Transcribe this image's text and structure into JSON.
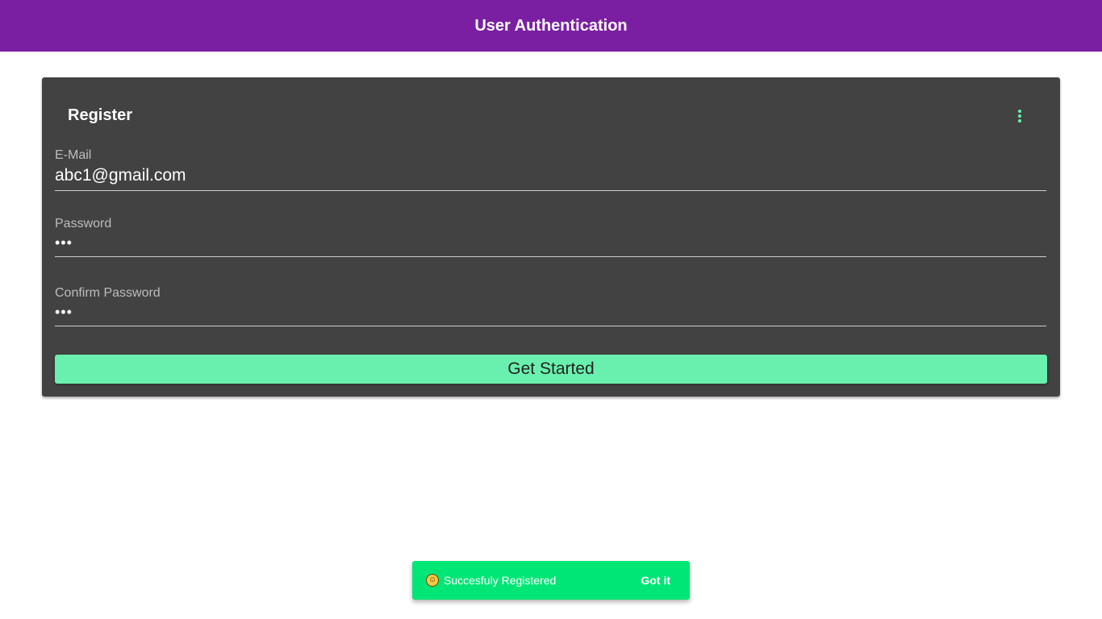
{
  "app_bar": {
    "title": "User Authentication",
    "color": "#7b1fa2"
  },
  "card": {
    "title": "Register",
    "menu_icon": "more-vert-icon",
    "fields": {
      "email": {
        "label": "E-Mail",
        "value": "abc1@gmail.com"
      },
      "password": {
        "label": "Password",
        "value": "•••"
      },
      "confirm_password": {
        "label": "Confirm Password",
        "value": "•••"
      }
    },
    "submit_label": "Get Started",
    "accent_color": "#69f0ae"
  },
  "snackbar": {
    "icon": "grinning-face-emoji",
    "message": "Succesfuly Registered",
    "action_label": "Got it",
    "color": "#00e676"
  }
}
